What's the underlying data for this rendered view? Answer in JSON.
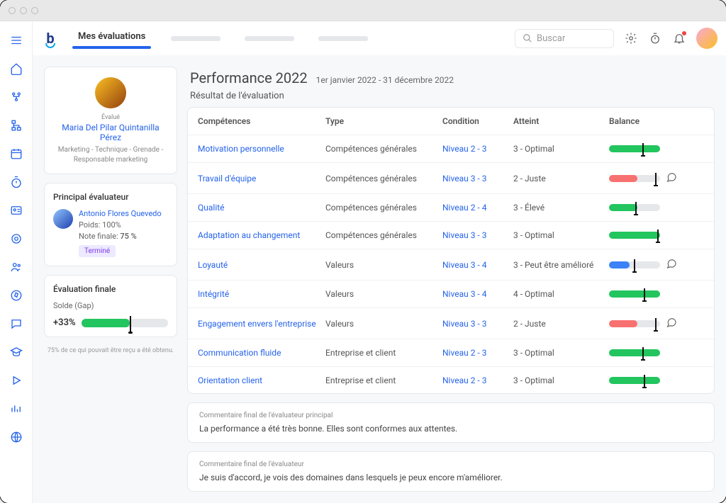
{
  "tabs": {
    "active": "Mes évaluations"
  },
  "search": {
    "placeholder": "Buscar"
  },
  "profile": {
    "eval_label": "Évalué",
    "name": "Maria Del Pilar Quintanilla Pérez",
    "meta": "Marketing - Technique - Grenade - Responsable marketing"
  },
  "evaluator_card": {
    "title": "Principal évaluateur",
    "name": "Antonio Flores Quevedo",
    "weight_label": "Poids:",
    "weight_value": "100%",
    "final_label": "Note finale:",
    "final_value": "75 %",
    "badge": "Terminé"
  },
  "final_eval": {
    "title": "Évaluation finale",
    "gap_label": "Solde (Gap)",
    "gap_value": "+33%"
  },
  "footnote": "75% de ce qui pouvait être reçu a été obtenu.",
  "page": {
    "title": "Performance 2022",
    "dates": "1er janvier 2022 - 31 décembre 2022",
    "subtitle": "Résultat de l'évaluation"
  },
  "columns": {
    "competences": "Compétences",
    "type": "Type",
    "condition": "Condition",
    "atteint": "Atteint",
    "balance": "Balance"
  },
  "rows": [
    {
      "comp": "Motivation personnelle",
      "type": "Compétences générales",
      "cond": "Niveau 2 - 3",
      "att": "3 - Optimal",
      "fill": 100,
      "mark": 65,
      "color": "green",
      "comment": false
    },
    {
      "comp": "Travail d'équipe",
      "type": "Compétences générales",
      "cond": "Niveau 3 - 3",
      "att": "2 - Juste",
      "fill": 55,
      "mark": 90,
      "color": "red",
      "comment": true
    },
    {
      "comp": "Qualité",
      "type": "Compétences générales",
      "cond": "Niveau 2 - 4",
      "att": "3 - Élevé",
      "fill": 55,
      "mark": 52,
      "color": "green",
      "comment": false
    },
    {
      "comp": "Adaptation au changement",
      "type": "Compétences générales",
      "cond": "Niveau 3 - 3",
      "att": "3 - Optimal",
      "fill": 100,
      "mark": 95,
      "color": "green",
      "comment": false
    },
    {
      "comp": "Loyauté",
      "type": "Valeurs",
      "cond": "Niveau 3 - 4",
      "att": "3 - Peut être amélioré",
      "fill": 40,
      "mark": 48,
      "color": "blue",
      "comment": true
    },
    {
      "comp": "Intégrité",
      "type": "Valeurs",
      "cond": "Niveau 3 - 4",
      "att": "4 - Optimal",
      "fill": 100,
      "mark": 68,
      "color": "green",
      "comment": false
    },
    {
      "comp": "Engagement envers l'entreprise",
      "type": "Valeurs",
      "cond": "Niveau 3 - 3",
      "att": "2 - Juste",
      "fill": 55,
      "mark": 90,
      "color": "red",
      "comment": true
    },
    {
      "comp": "Communication fluide",
      "type": "Entreprise et client",
      "cond": "Niveau 2 - 3",
      "att": "3 - Optimal",
      "fill": 100,
      "mark": 65,
      "color": "green",
      "comment": false
    },
    {
      "comp": "Orientation client",
      "type": "Entreprise et client",
      "cond": "Niveau 2 - 3",
      "att": "3 - Optimal",
      "fill": 100,
      "mark": 68,
      "color": "green",
      "comment": false
    }
  ],
  "comments": [
    {
      "title": "Commentaire final de l'évaluateur principal",
      "text": "La performance a été très bonne. Elles sont conformes aux attentes."
    },
    {
      "title": "Commentaire final de l'évaluateur",
      "text": "Je suis d'accord, je vois des domaines dans lesquels je peux encore m'améliorer."
    }
  ]
}
